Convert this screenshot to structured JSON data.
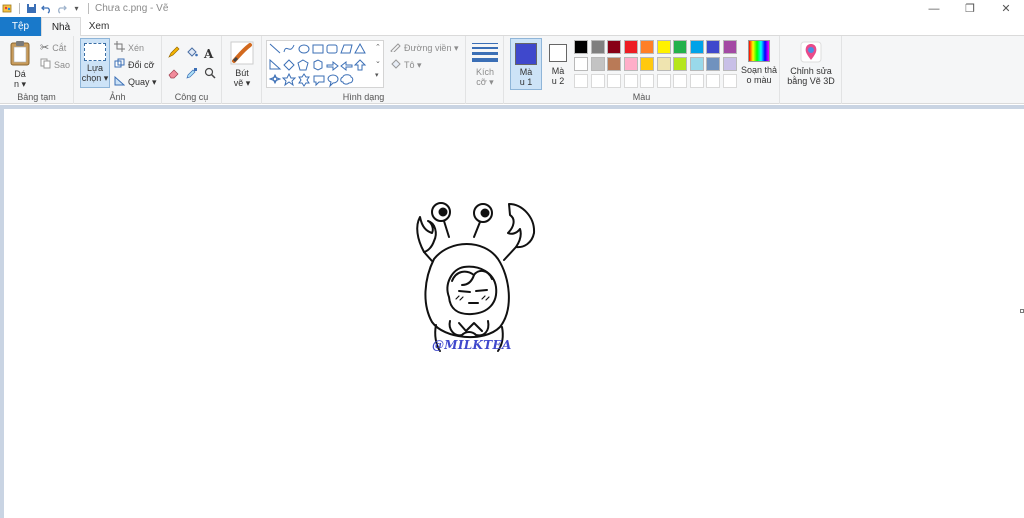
{
  "window": {
    "title": "Chưa c.png - Vẽ",
    "controls": [
      "—",
      "❐",
      "✕"
    ]
  },
  "tabs": {
    "file": "Tệp",
    "home": "Nhà",
    "view": "Xem"
  },
  "clipboard": {
    "paste_line1": "Dá",
    "paste_line2": "n ▾",
    "cut": "Cắt",
    "copy": "Sao",
    "label": "Bảng tạm"
  },
  "image": {
    "select_line1": "Lựa",
    "select_line2": "chọn ▾",
    "crop": "Xén",
    "resize": "Đổi cỡ",
    "rotate": "Quay ▾",
    "label": "Ảnh"
  },
  "tools": {
    "label": "Công cụ"
  },
  "brushes": {
    "line1": "Bút",
    "line2": "vẽ ▾"
  },
  "shapes": {
    "outline": "Đường viền ▾",
    "fill": "Tô ▾",
    "label": "Hình dạng"
  },
  "size": {
    "line1": "Kích",
    "line2": "cỡ ▾"
  },
  "colors": {
    "color1_line1": "Mà",
    "color1_line2": "u 1",
    "color2_line1": "Mà",
    "color2_line2": "u 2",
    "color1_value": "#3f48cc",
    "color2_value": "#ffffff",
    "edit_line1": "Soạn thả",
    "edit_line2": "o màu",
    "label": "Màu",
    "palette_row1": [
      "#000000",
      "#7f7f7f",
      "#880015",
      "#ed1c24",
      "#ff7f27",
      "#fff200",
      "#22b14c",
      "#00a2e8",
      "#3f48cc",
      "#a349a4"
    ],
    "palette_row2": [
      "#ffffff",
      "#c3c3c3",
      "#b97a57",
      "#ffaec9",
      "#ffc90e",
      "#efe4b0",
      "#b5e61d",
      "#99d9ea",
      "#7092be",
      "#c8bfe7"
    ]
  },
  "paint3d": {
    "line1": "Chỉnh sửa",
    "line2": "bằng Vẽ 3D"
  },
  "drawing": {
    "watermark": "@MILKTEA"
  }
}
